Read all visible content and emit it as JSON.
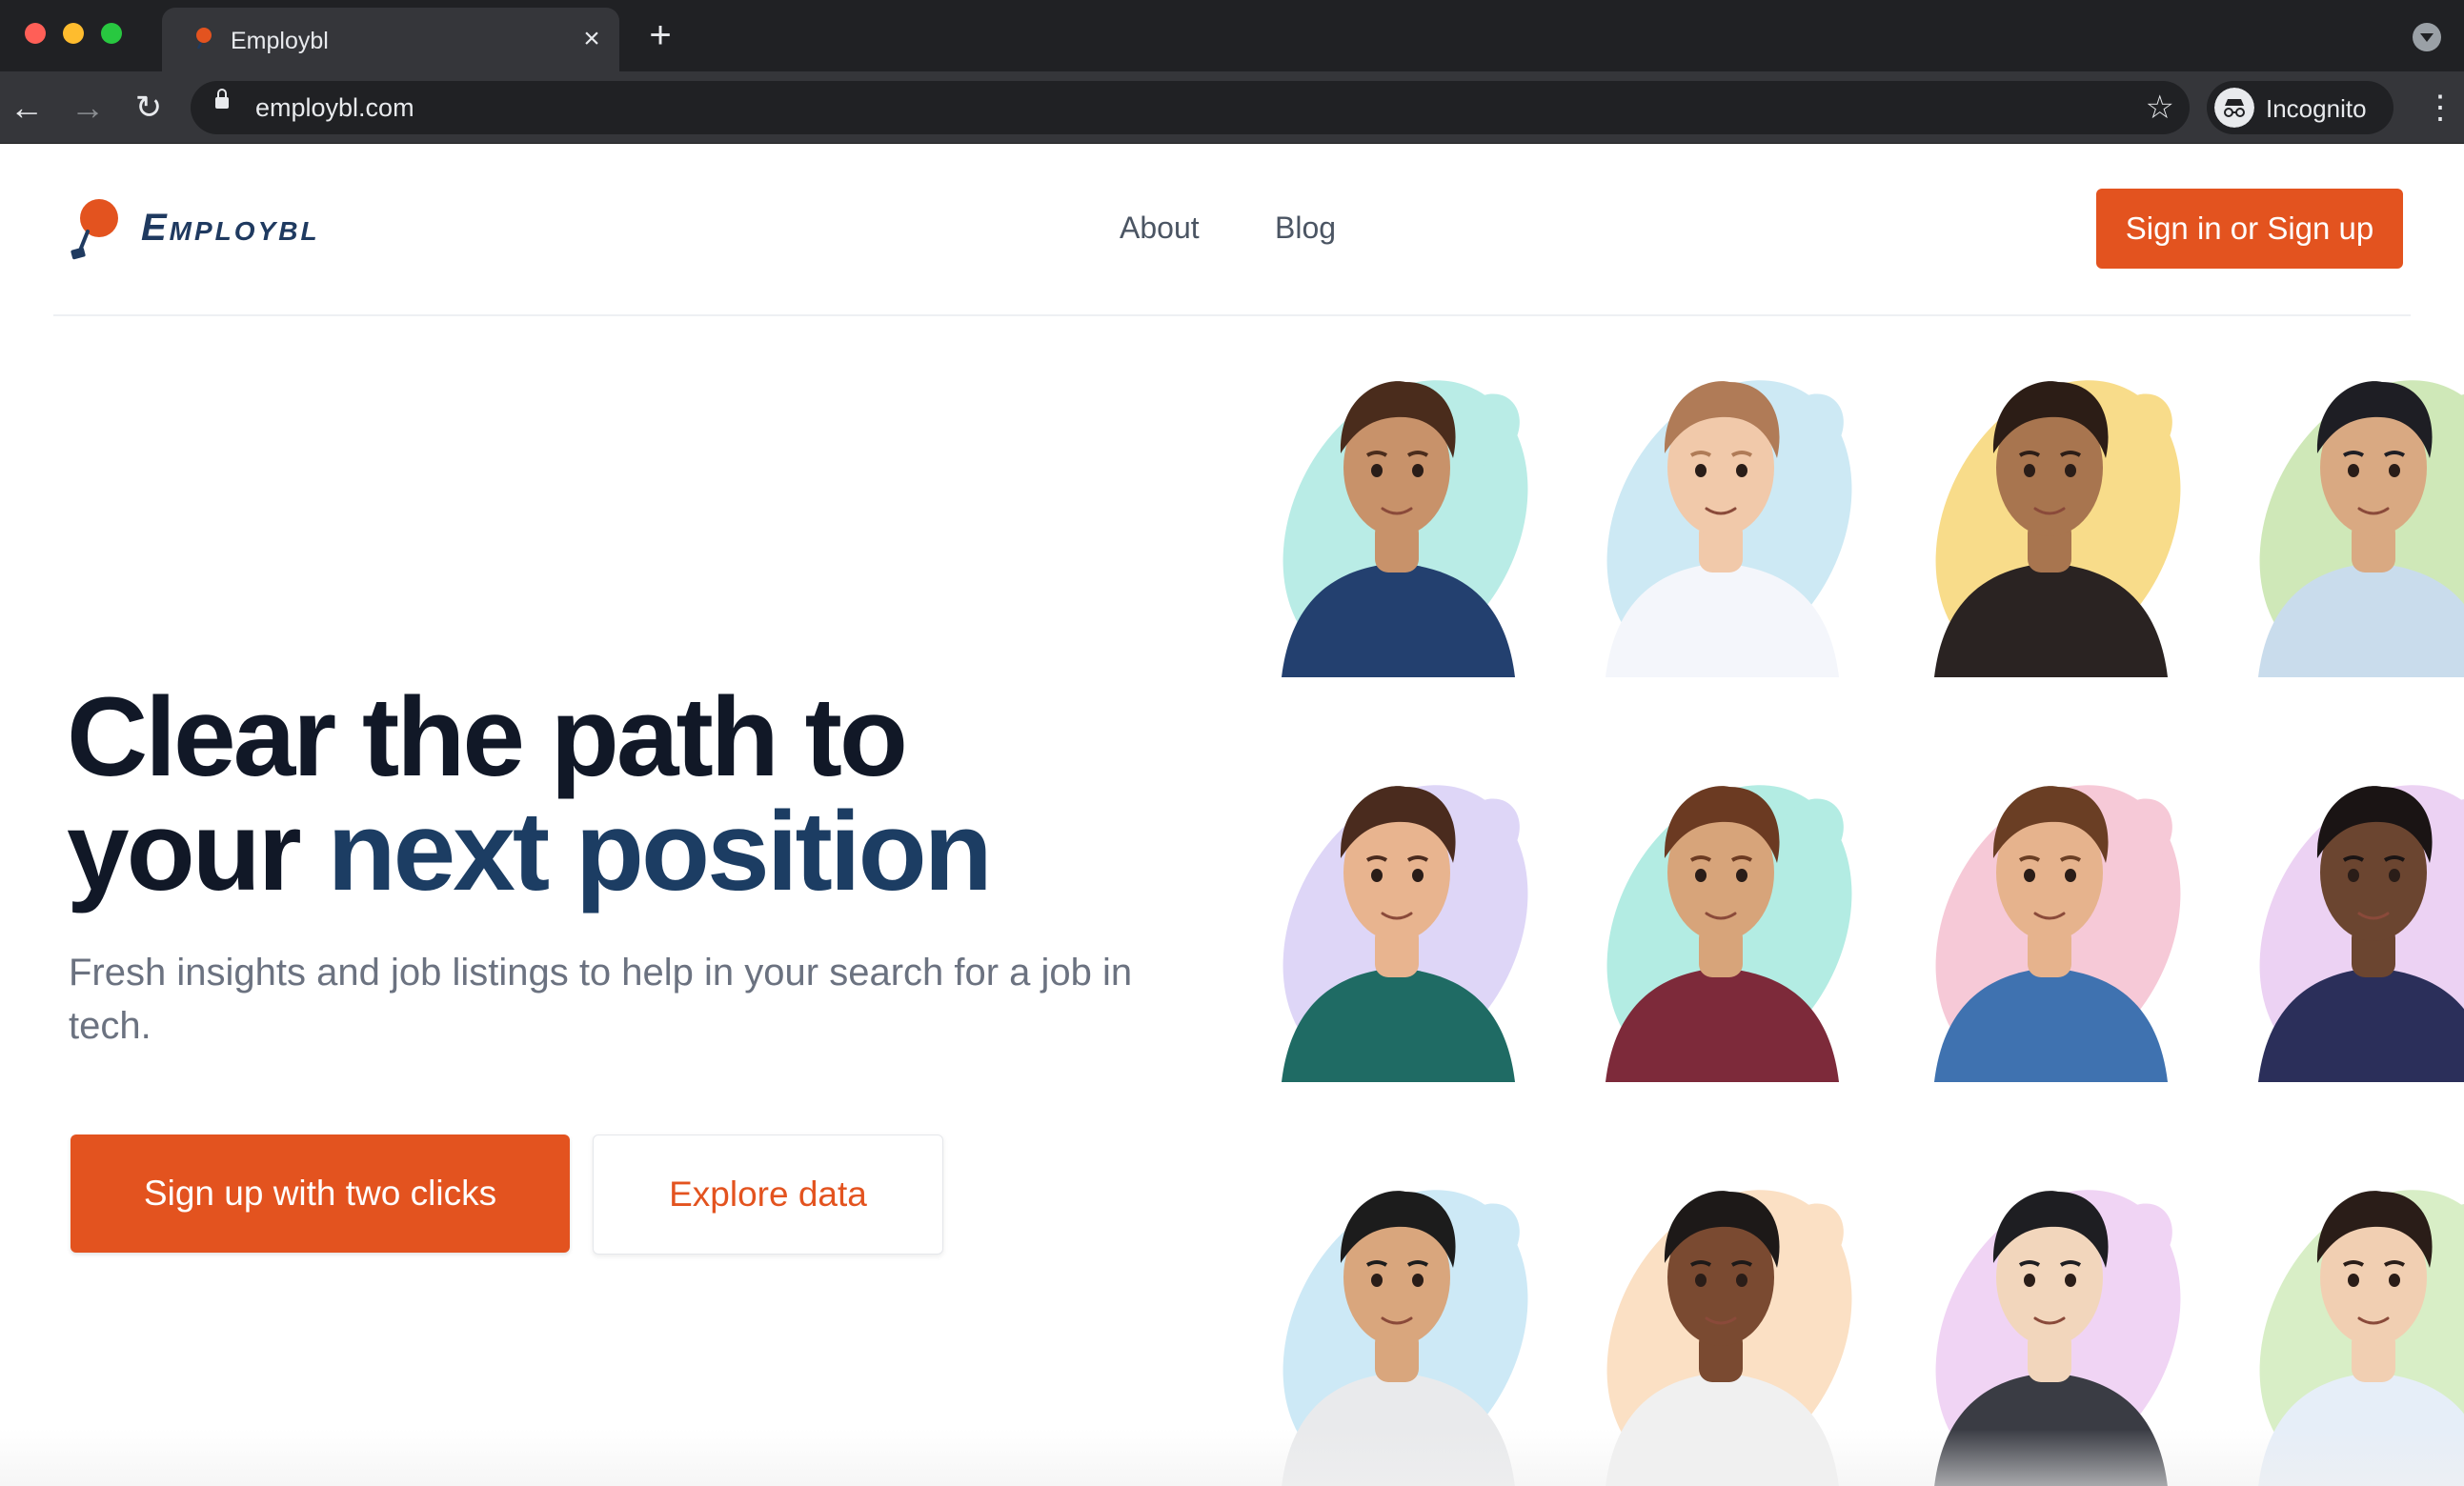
{
  "browser": {
    "tab_title": "Employbl",
    "url": "employbl.com",
    "profile_label": "Incognito",
    "new_tab_glyph": "+",
    "close_glyph": "×"
  },
  "site": {
    "brand": "Employbl",
    "nav": {
      "about": "About",
      "blog": "Blog"
    },
    "signin_label": "Sign in or Sign up",
    "accent_color": "#e3531f",
    "navy_color": "#1c3d63"
  },
  "hero": {
    "title_line1": "Clear the path to",
    "title_line2_plain": "your",
    "title_line2_accent": "next position",
    "subtitle": "Fresh insights and job listings to help in your search for a job in tech.",
    "primary_cta": "Sign up with two clicks",
    "secondary_cta": "Explore data"
  },
  "avatars": [
    {
      "name": "avatar-man-glasses",
      "blob": "#b9ece6",
      "shirt": "#23406f",
      "skin": "#c8926a",
      "hair": "#4a2c1c"
    },
    {
      "name": "avatar-woman-wavy-blonde",
      "blob": "#cde9f4",
      "shirt": "#f4f6fb",
      "skin": "#f1c9aa",
      "hair": "#b07b57"
    },
    {
      "name": "avatar-man-short-hair",
      "blob": "#f8dc8a",
      "shirt": "#2a2322",
      "skin": "#a8754f",
      "hair": "#2c1d16"
    },
    {
      "name": "avatar-woman-denim-shirt",
      "blob": "#cfe8b8",
      "shirt": "#c9dcec",
      "skin": "#d9a982",
      "hair": "#1e1e24"
    },
    {
      "name": "avatar-woman-long-brown",
      "blob": "#ded6f7",
      "shirt": "#1f6b64",
      "skin": "#e8b48f",
      "hair": "#4a2b1e"
    },
    {
      "name": "avatar-man-beard-quiff",
      "blob": "#b3ece3",
      "shirt": "#7d2a3a",
      "skin": "#d7a47a",
      "hair": "#6b3a22"
    },
    {
      "name": "avatar-woman-denim-top",
      "blob": "#f6c9d7",
      "shirt": "#3f72b0",
      "skin": "#e6b38d",
      "hair": "#6a3e24"
    },
    {
      "name": "avatar-man-navy-sweater",
      "blob": "#ecd2f3",
      "shirt": "#2b2f5a",
      "skin": "#6b4530",
      "hair": "#1a1414"
    },
    {
      "name": "avatar-man-cap-beard",
      "blob": "#cde9f6",
      "shirt": "#e9eaec",
      "skin": "#d9a67d",
      "hair": "#1c1c1c"
    },
    {
      "name": "avatar-woman-turtleneck",
      "blob": "#fbe0c4",
      "shirt": "#f0f0f0",
      "skin": "#7a4a31",
      "hair": "#1d1918"
    },
    {
      "name": "avatar-man-dark-hair",
      "blob": "#f0d4f4",
      "shirt": "#3a3c44",
      "skin": "#f2d6bc",
      "hair": "#1e1e22"
    },
    {
      "name": "avatar-woman-bob",
      "blob": "#d8eec6",
      "shirt": "#e6eef8",
      "skin": "#f1cfb2",
      "hair": "#2a1d18"
    }
  ]
}
